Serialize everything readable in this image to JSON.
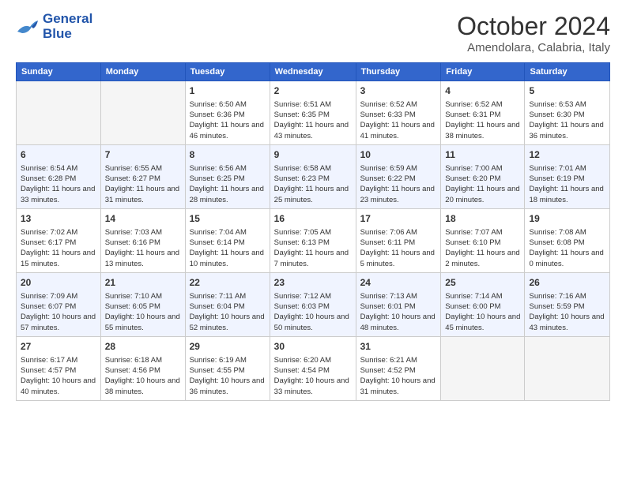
{
  "header": {
    "logo_line1": "General",
    "logo_line2": "Blue",
    "month_title": "October 2024",
    "location": "Amendolara, Calabria, Italy"
  },
  "days_of_week": [
    "Sunday",
    "Monday",
    "Tuesday",
    "Wednesday",
    "Thursday",
    "Friday",
    "Saturday"
  ],
  "weeks": [
    [
      {
        "day": "",
        "info": ""
      },
      {
        "day": "",
        "info": ""
      },
      {
        "day": "1",
        "info": "Sunrise: 6:50 AM\nSunset: 6:36 PM\nDaylight: 11 hours and 46 minutes."
      },
      {
        "day": "2",
        "info": "Sunrise: 6:51 AM\nSunset: 6:35 PM\nDaylight: 11 hours and 43 minutes."
      },
      {
        "day": "3",
        "info": "Sunrise: 6:52 AM\nSunset: 6:33 PM\nDaylight: 11 hours and 41 minutes."
      },
      {
        "day": "4",
        "info": "Sunrise: 6:52 AM\nSunset: 6:31 PM\nDaylight: 11 hours and 38 minutes."
      },
      {
        "day": "5",
        "info": "Sunrise: 6:53 AM\nSunset: 6:30 PM\nDaylight: 11 hours and 36 minutes."
      }
    ],
    [
      {
        "day": "6",
        "info": "Sunrise: 6:54 AM\nSunset: 6:28 PM\nDaylight: 11 hours and 33 minutes."
      },
      {
        "day": "7",
        "info": "Sunrise: 6:55 AM\nSunset: 6:27 PM\nDaylight: 11 hours and 31 minutes."
      },
      {
        "day": "8",
        "info": "Sunrise: 6:56 AM\nSunset: 6:25 PM\nDaylight: 11 hours and 28 minutes."
      },
      {
        "day": "9",
        "info": "Sunrise: 6:58 AM\nSunset: 6:23 PM\nDaylight: 11 hours and 25 minutes."
      },
      {
        "day": "10",
        "info": "Sunrise: 6:59 AM\nSunset: 6:22 PM\nDaylight: 11 hours and 23 minutes."
      },
      {
        "day": "11",
        "info": "Sunrise: 7:00 AM\nSunset: 6:20 PM\nDaylight: 11 hours and 20 minutes."
      },
      {
        "day": "12",
        "info": "Sunrise: 7:01 AM\nSunset: 6:19 PM\nDaylight: 11 hours and 18 minutes."
      }
    ],
    [
      {
        "day": "13",
        "info": "Sunrise: 7:02 AM\nSunset: 6:17 PM\nDaylight: 11 hours and 15 minutes."
      },
      {
        "day": "14",
        "info": "Sunrise: 7:03 AM\nSunset: 6:16 PM\nDaylight: 11 hours and 13 minutes."
      },
      {
        "day": "15",
        "info": "Sunrise: 7:04 AM\nSunset: 6:14 PM\nDaylight: 11 hours and 10 minutes."
      },
      {
        "day": "16",
        "info": "Sunrise: 7:05 AM\nSunset: 6:13 PM\nDaylight: 11 hours and 7 minutes."
      },
      {
        "day": "17",
        "info": "Sunrise: 7:06 AM\nSunset: 6:11 PM\nDaylight: 11 hours and 5 minutes."
      },
      {
        "day": "18",
        "info": "Sunrise: 7:07 AM\nSunset: 6:10 PM\nDaylight: 11 hours and 2 minutes."
      },
      {
        "day": "19",
        "info": "Sunrise: 7:08 AM\nSunset: 6:08 PM\nDaylight: 11 hours and 0 minutes."
      }
    ],
    [
      {
        "day": "20",
        "info": "Sunrise: 7:09 AM\nSunset: 6:07 PM\nDaylight: 10 hours and 57 minutes."
      },
      {
        "day": "21",
        "info": "Sunrise: 7:10 AM\nSunset: 6:05 PM\nDaylight: 10 hours and 55 minutes."
      },
      {
        "day": "22",
        "info": "Sunrise: 7:11 AM\nSunset: 6:04 PM\nDaylight: 10 hours and 52 minutes."
      },
      {
        "day": "23",
        "info": "Sunrise: 7:12 AM\nSunset: 6:03 PM\nDaylight: 10 hours and 50 minutes."
      },
      {
        "day": "24",
        "info": "Sunrise: 7:13 AM\nSunset: 6:01 PM\nDaylight: 10 hours and 48 minutes."
      },
      {
        "day": "25",
        "info": "Sunrise: 7:14 AM\nSunset: 6:00 PM\nDaylight: 10 hours and 45 minutes."
      },
      {
        "day": "26",
        "info": "Sunrise: 7:16 AM\nSunset: 5:59 PM\nDaylight: 10 hours and 43 minutes."
      }
    ],
    [
      {
        "day": "27",
        "info": "Sunrise: 6:17 AM\nSunset: 4:57 PM\nDaylight: 10 hours and 40 minutes."
      },
      {
        "day": "28",
        "info": "Sunrise: 6:18 AM\nSunset: 4:56 PM\nDaylight: 10 hours and 38 minutes."
      },
      {
        "day": "29",
        "info": "Sunrise: 6:19 AM\nSunset: 4:55 PM\nDaylight: 10 hours and 36 minutes."
      },
      {
        "day": "30",
        "info": "Sunrise: 6:20 AM\nSunset: 4:54 PM\nDaylight: 10 hours and 33 minutes."
      },
      {
        "day": "31",
        "info": "Sunrise: 6:21 AM\nSunset: 4:52 PM\nDaylight: 10 hours and 31 minutes."
      },
      {
        "day": "",
        "info": ""
      },
      {
        "day": "",
        "info": ""
      }
    ]
  ]
}
